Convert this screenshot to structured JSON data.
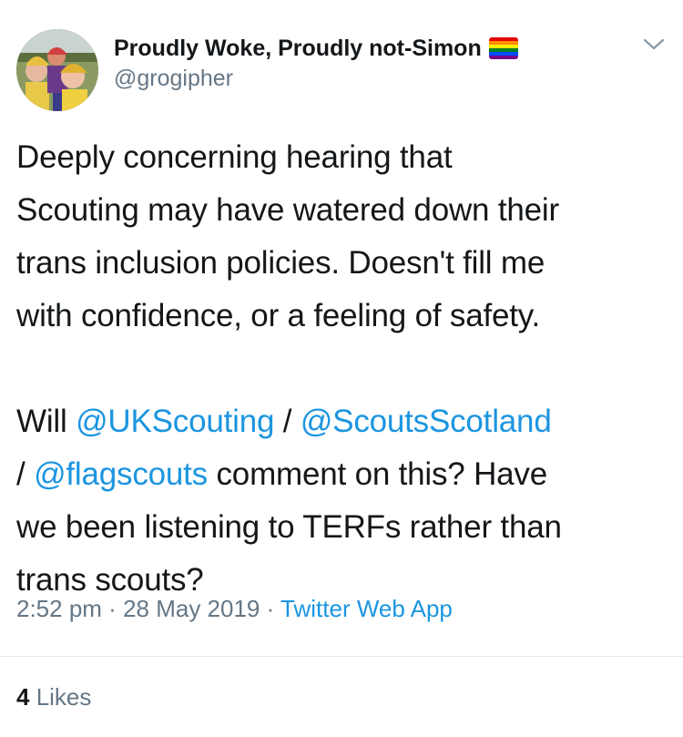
{
  "author": {
    "display_name": "Proudly Woke, Proudly not-Simon",
    "handle": "@grogipher",
    "flag_icon": "rainbow-flag-icon"
  },
  "menu_icon": "chevron-down-icon",
  "tweet": {
    "paragraph1": "Deeply concerning hearing that\nScouting may have watered down their\ntrans inclusion policies. Doesn't fill me\nwith confidence, or a feeling of safety.",
    "p2_will": "Will ",
    "mention1": "@UKScouting",
    "sep1": " / ",
    "mention2": "@ScoutsScotland",
    "sep2": "\n/ ",
    "mention3": "@flagscouts",
    "p2_rest": " comment on this? Have\nwe been listening to TERFs rather than\ntrans scouts?"
  },
  "meta": {
    "time": "2:52 pm",
    "dot1": " · ",
    "date": "28 May 2019",
    "dot2": " · ",
    "source": "Twitter Web App"
  },
  "likes": {
    "count": "4",
    "label": " Likes"
  },
  "colors": {
    "link": "#1b95e0",
    "secondary": "#657786",
    "text": "#14171a"
  }
}
